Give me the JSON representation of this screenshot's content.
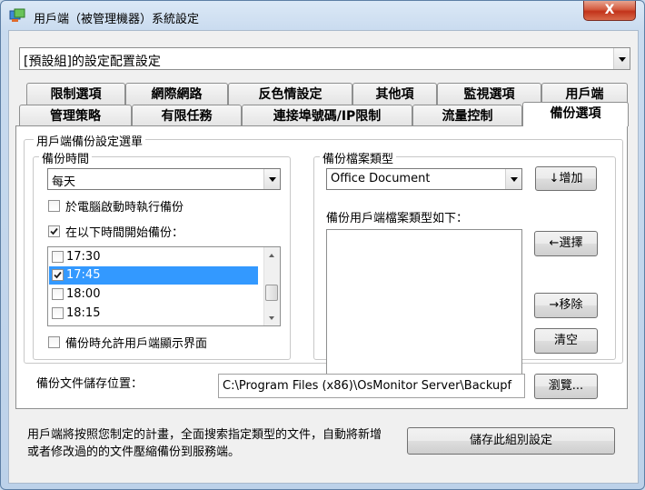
{
  "window": {
    "title": "用戶端（被管理機器）系統設定",
    "close_label": "X"
  },
  "config_select": {
    "value": "[預設組]的設定配置設定"
  },
  "tabs": {
    "row1": [
      "限制選項",
      "網際網路",
      "反色情設定",
      "其他項",
      "監視選項",
      "用戶端"
    ],
    "row2": [
      "管理策略",
      "有限任務",
      "連接埠號碼/IP限制",
      "流量控制",
      "備份選項"
    ],
    "active": "備份選項"
  },
  "backup": {
    "outer_group": "用戶端備份設定選單",
    "time_group": "備份時間",
    "frequency": "每天",
    "on_boot_label": "於電腦啟動時執行備份",
    "on_boot_checked": false,
    "start_at_label": "在以下時間開始備份：",
    "start_at_checked": true,
    "times": [
      {
        "time": "17:30",
        "checked": false,
        "selected": false
      },
      {
        "time": "17:45",
        "checked": true,
        "selected": true
      },
      {
        "time": "18:00",
        "checked": false,
        "selected": false
      },
      {
        "time": "18:15",
        "checked": false,
        "selected": false
      }
    ],
    "show_ui_label": "備份時允許用戶端顯示界面",
    "show_ui_checked": false,
    "filetype_group": "備份檔案類型",
    "filetype_value": "Office Document",
    "add_button": "↓增加",
    "list_label": "備份用戶端檔案類型如下：",
    "select_button": "←選擇",
    "remove_button": "→移除",
    "clear_button": "清空",
    "storage_label": "備份文件儲存位置：",
    "storage_path": "C:\\Program Files (x86)\\OsMonitor Server\\Backupf",
    "browse_button": "瀏覽..."
  },
  "footer": {
    "description": "用戶端將按照您制定的計畫，全面搜索指定類型的文件，自動將新增或者修改過的的文件壓縮備份到服務端。",
    "save_button": "儲存此組別設定"
  },
  "colors": {
    "selection": "#3399ff",
    "close_button": "#c7391e"
  },
  "icons": [
    "app-icon",
    "close-icon",
    "checkmark-icon",
    "dropdown-arrow-icon",
    "scroll-up-icon",
    "scroll-down-icon"
  ]
}
